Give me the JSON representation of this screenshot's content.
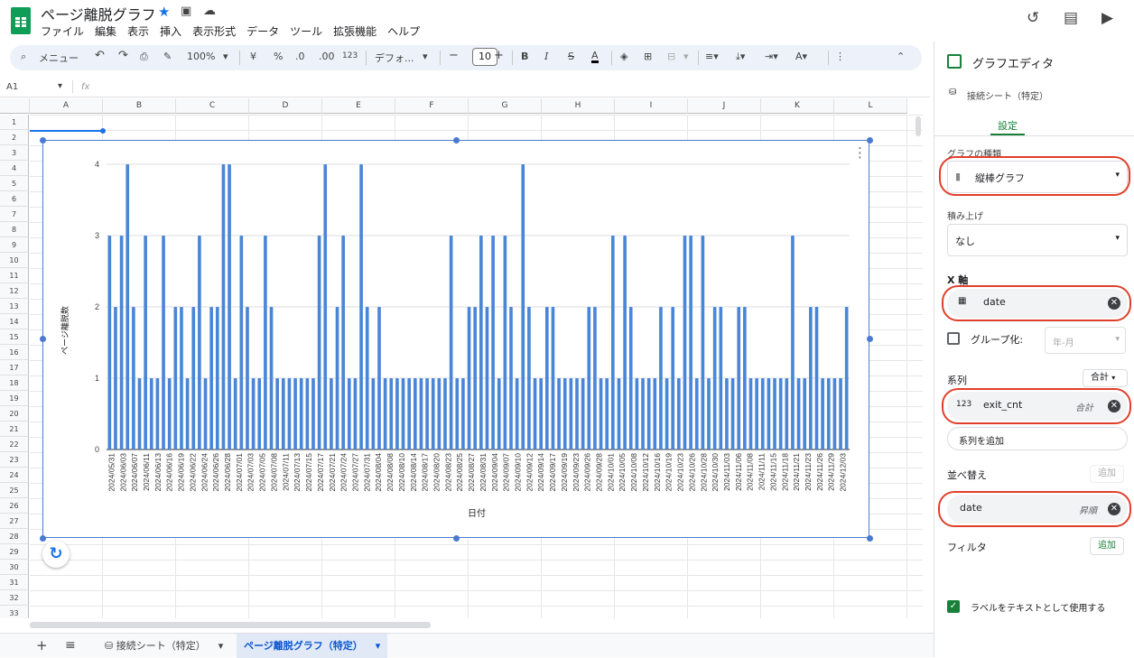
{
  "app": {
    "doc_title": "ページ離脱グラフ",
    "menu": [
      "ファイル",
      "編集",
      "表示",
      "挿入",
      "表示形式",
      "データ",
      "ツール",
      "拡張機能",
      "ヘルプ"
    ]
  },
  "toolbar": {
    "search": "メニュー",
    "zoom": "100%",
    "currency": "¥",
    "percent": "%",
    "dec_less": ".0",
    "dec_more": ".00",
    "number_format": "123",
    "font": "デフォ...",
    "font_size": "10",
    "bold": "B",
    "italic": "I",
    "strike": "S",
    "text_color": "A"
  },
  "formula_bar": {
    "cell_ref": "A1",
    "fx": "fx",
    "value": ""
  },
  "grid": {
    "columns": [
      "A",
      "B",
      "C",
      "D",
      "E",
      "F",
      "G",
      "H",
      "I",
      "J",
      "K",
      "L"
    ],
    "rows": [
      "1",
      "2",
      "3",
      "4",
      "5",
      "6",
      "7",
      "8",
      "9",
      "10",
      "11",
      "12",
      "13",
      "14",
      "15",
      "16",
      "17",
      "18",
      "19",
      "20",
      "21",
      "22",
      "23",
      "24",
      "25",
      "26",
      "27",
      "28",
      "29",
      "30",
      "31",
      "32",
      "33"
    ]
  },
  "chart_data": {
    "type": "bar",
    "title": "",
    "xlabel": "日付",
    "ylabel": "ページ離脱数",
    "ylim": [
      0,
      4
    ],
    "yticks": [
      "0",
      "1",
      "2",
      "3",
      "4"
    ],
    "grid": true,
    "color": "#4a86d8",
    "tick_labels": [
      "2024/05/31",
      "2024/06/03",
      "2024/06/07",
      "2024/06/11",
      "2024/06/13",
      "2024/06/16",
      "2024/06/19",
      "2024/06/22",
      "2024/06/24",
      "2024/06/26",
      "2024/06/28",
      "2024/07/01",
      "2024/07/03",
      "2024/07/05",
      "2024/07/08",
      "2024/07/11",
      "2024/07/13",
      "2024/07/15",
      "2024/07/17",
      "2024/07/21",
      "2024/07/24",
      "2024/07/27",
      "2024/07/31",
      "2024/08/04",
      "2024/08/08",
      "2024/08/10",
      "2024/08/14",
      "2024/08/17",
      "2024/08/20",
      "2024/08/23",
      "2024/08/25",
      "2024/08/27",
      "2024/08/31",
      "2024/09/04",
      "2024/09/07",
      "2024/09/10",
      "2024/09/12",
      "2024/09/14",
      "2024/09/17",
      "2024/09/19",
      "2024/09/23",
      "2024/09/26",
      "2024/09/28",
      "2024/10/01",
      "2024/10/05",
      "2024/10/08",
      "2024/10/12",
      "2024/10/16",
      "2024/10/19",
      "2024/10/23",
      "2024/10/26",
      "2024/10/28",
      "2024/10/30",
      "2024/11/03",
      "2024/11/06",
      "2024/11/08",
      "2024/11/11",
      "2024/11/15",
      "2024/11/18",
      "2024/11/21",
      "2024/11/23",
      "2024/11/26",
      "2024/11/29",
      "2024/12/03"
    ],
    "values": [
      3,
      2,
      3,
      4,
      2,
      1,
      3,
      1,
      1,
      3,
      1,
      2,
      2,
      1,
      2,
      3,
      1,
      2,
      2,
      4,
      4,
      1,
      3,
      2,
      1,
      1,
      3,
      2,
      1,
      1,
      1,
      1,
      1,
      1,
      1,
      3,
      4,
      1,
      2,
      3,
      1,
      1,
      4,
      2,
      1,
      2,
      1,
      1,
      1,
      1,
      1,
      1,
      1,
      1,
      1,
      1,
      1,
      3,
      1,
      1,
      2,
      2,
      3,
      2,
      3,
      1,
      3,
      2,
      1,
      4,
      2,
      1,
      1,
      2,
      2,
      1,
      1,
      1,
      1,
      1,
      2,
      2,
      1,
      1,
      3,
      1,
      3,
      2,
      1,
      1,
      1,
      1,
      2,
      1,
      2,
      1,
      3,
      3,
      1,
      3,
      1,
      2,
      2,
      1,
      1,
      2,
      2,
      1,
      1,
      1,
      1,
      1,
      1,
      1,
      3,
      1,
      1,
      2,
      2,
      1,
      1,
      1,
      1,
      2
    ]
  },
  "panel": {
    "title": "グラフエディタ",
    "source": "接続シート（特定）",
    "tab": "設定",
    "chart_type_label": "グラフの種類",
    "chart_type": "縦棒グラフ",
    "stack_label": "積み上げ",
    "stack_value": "なし",
    "x_axis_label": "X 軸",
    "x_axis_field": "date",
    "group_label": "グループ化:",
    "group_value": "年-月",
    "series_label": "系列",
    "series_agg": "合計",
    "series_field": "exit_cnt",
    "series_field_agg": "合計",
    "add_series": "系列を追加",
    "sort_label": "並べ替え",
    "sort_add": "追加",
    "sort_field": "date",
    "sort_order": "昇順",
    "filter_label": "フィルタ",
    "filter_add": "追加",
    "use_labels": "ラベルをテキストとして使用する"
  },
  "tabs": {
    "sheet1": "接続シート（特定）",
    "sheet2": "ページ離脱グラフ（特定）"
  }
}
